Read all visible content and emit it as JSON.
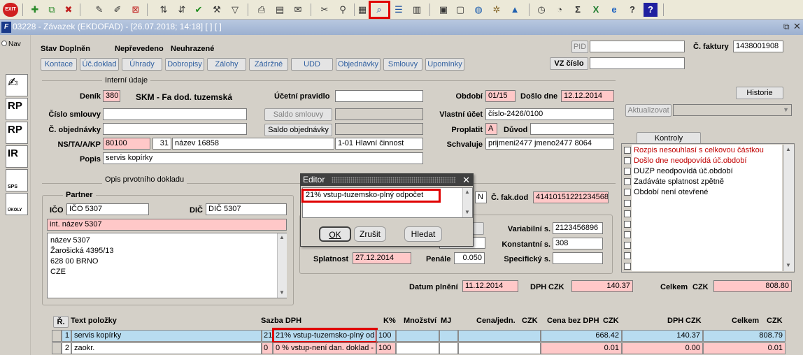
{
  "window": {
    "title": "03228 - Závazek (EKDOFAD) - [26.07.2018; 14:18]  [ ]  [ ]",
    "nav_label": "Nav"
  },
  "toolbar": {
    "exit_label": "EXIT",
    "icons": [
      "exit-icon",
      "add-record-icon",
      "copy-record-icon",
      "delete-record-icon",
      "edit-icon",
      "edit-all-icon",
      "cancel-edit-icon",
      "sort-asc-icon",
      "sort-desc-icon",
      "confirm-check-icon",
      "tools-icon",
      "filter-icon",
      "print-icon",
      "print-preview-icon",
      "mail-icon",
      "cut-icon",
      "attach-icon",
      "calc-icon",
      "search-zoom-icon",
      "list-icon",
      "grid-icon",
      "calendar-icon",
      "document-icon",
      "globe-icon",
      "settings-icon",
      "triangle-icon",
      "clock-icon",
      "speedometer-icon",
      "sigma-icon",
      "excel-icon",
      "ie-icon",
      "help-icon",
      "context-help-icon"
    ]
  },
  "left_nav": {
    "buttons": [
      {
        "name": "signature-icon",
        "label": ""
      },
      {
        "name": "rp-cz-icon",
        "label": "RP"
      },
      {
        "name": "rp-eu-icon",
        "label": "RP"
      },
      {
        "name": "ir-cz-icon",
        "label": "IR"
      },
      {
        "name": "sps-icon",
        "label": "SPS"
      },
      {
        "name": "ukoly-icon",
        "label": "ÚKOLY"
      }
    ]
  },
  "header": {
    "stav_label": "Stav",
    "stav_value": "Doplněn",
    "neprevedeno": "Nepřevedeno",
    "neuhrazene": "Neuhrazené",
    "pid_label": "PID",
    "cislo_faktury_label": "Č. faktury",
    "cislo_faktury": "1438001908",
    "vz_cislo_label": "VZ číslo"
  },
  "tabs": [
    "Kontace",
    "Úč.doklad",
    "Úhrady",
    "Dobropisy",
    "Zálohy",
    "Zádržné",
    "UDD",
    "Objednávky",
    "Smlouvy",
    "Upomínky"
  ],
  "interni": {
    "section_title": "Interní údaje",
    "denik_label": "Deník",
    "denik_value": "380",
    "denik_name": "SKM - Fa dod. tuzemská",
    "ucetni_pravidlo_label": "Účetní pravidlo",
    "cislo_smlouvy_label": "Číslo smlouvy",
    "saldo_smlouvy_btn": "Saldo smlouvy",
    "c_objednavky_label": "Č. objednávky",
    "saldo_objednavky_btn": "Saldo objednávky",
    "ns_label": "NS/TA/A/KP",
    "ns_value": "80100",
    "ta_value": "31",
    "a_value": "název 16858",
    "kp_value": "1-01 Hlavní činnost",
    "popis_label": "Popis",
    "popis_value": "servis kopírky",
    "obdobi_label": "Období",
    "obdobi_value": "01/15",
    "doslo_dne_label": "Došlo dne",
    "doslo_dne_value": "12.12.2014",
    "vlastni_ucet_label": "Vlastní účet",
    "vlastni_ucet_value": "číslo-2426/0100",
    "proplatit_label": "Proplatit",
    "proplatit_value": "A",
    "duvod_label": "Důvod",
    "schvaluje_label": "Schvaluje",
    "schvaluje_value": "prijmeni2477 jmeno2477 8064"
  },
  "right_panel": {
    "historie_btn": "Historie",
    "aktualizovat_btn": "Aktualizovat",
    "kontroly_btn": "Kontroly",
    "checks": [
      {
        "text": "Rozpis nesouhlasí s celkovou částkou",
        "color": "#c00000"
      },
      {
        "text": "Došlo dne neodpovídá úč.období",
        "color": "#c00000"
      },
      {
        "text": "DUZP neodpovídá úč.období",
        "color": "#000000"
      },
      {
        "text": "Zadáváte splatnost zpětně",
        "color": "#000000"
      },
      {
        "text": "Období není otevřené",
        "color": "#000000"
      }
    ]
  },
  "opis": {
    "section_title": "Opis prvotního dokladu",
    "partner_title": "Partner",
    "ico_label": "IČO",
    "ico_value": "IČO 5307",
    "dic_label": "DIČ",
    "dic_value": "DIČ 5307",
    "int_nazev": "int. název 5307",
    "address": [
      "název 5307",
      "Žarošická 4395/13",
      "628 00 BRNO",
      "CZE"
    ],
    "n_value": "N",
    "c_fak_dod_label": "Č. fak.dod",
    "c_fak_dod_value": "41410151221234568",
    "variabilni_label": "Variabilní s.",
    "variabilni_value": "2123456896",
    "konstantni_label": "Konstantní s.",
    "konstantni_value": "308",
    "specificky_label": "Specifický s.",
    "splatnost_label": "Splatnost",
    "splatnost_value": "27.12.2014",
    "penale_label": "Penále",
    "penale_value": "0.050",
    "datum_plneni_label": "Datum plnění",
    "datum_plneni_value": "11.12.2014",
    "dph_label": "DPH",
    "dph_currency": "CZK",
    "dph_value": "140.37",
    "celkem_label": "Celkem",
    "celkem_currency": "CZK",
    "celkem_value": "808.80"
  },
  "editor": {
    "title": "Editor",
    "text": "21% vstup-tuzemsko-plný odpočet",
    "ok_btn": "OK",
    "zrusit_btn": "Zrušit",
    "hledat_btn": "Hledat"
  },
  "grid": {
    "headers": {
      "r": "Ř.",
      "text": "Text položky",
      "sazba": "Sazba DPH",
      "k": "K%",
      "mnozstvi": "Množství",
      "mj": "MJ",
      "cena_jedn": "Cena/jedn.",
      "cena_jedn_cur": "CZK",
      "cena_bez": "Cena bez DPH",
      "cena_bez_cur": "CZK",
      "dph": "DPH",
      "dph_cur": "CZK",
      "celkem": "Celkem",
      "celkem_cur": "CZK"
    },
    "rows": [
      {
        "r": "1",
        "text": "servis kopírky",
        "sazba_code": "21",
        "sazba": "21% vstup-tuzemsko-plný od",
        "k": "100",
        "mnozstvi": "",
        "mj": "",
        "cena_jedn": "",
        "cena_bez": "668.42",
        "dph": "140.37",
        "celkem": "808.79"
      },
      {
        "r": "2",
        "text": "zaokr.",
        "sazba_code": "0",
        "sazba": "0 % vstup-není dan. doklad -",
        "k": "100",
        "mnozstvi": "",
        "mj": "",
        "cena_jedn": "",
        "cena_bez": "0.01",
        "dph": "0.00",
        "celkem": "0.01"
      }
    ]
  }
}
